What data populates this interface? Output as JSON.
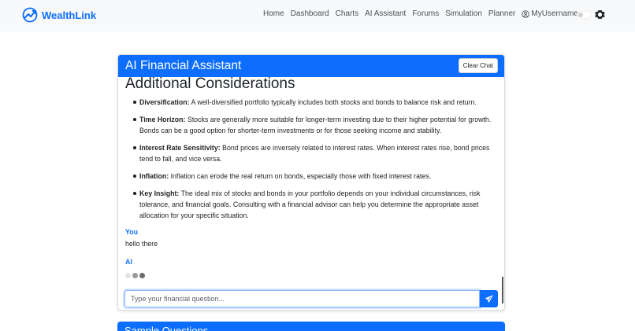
{
  "brand": {
    "name": "WealthLink",
    "icon": "chart-up-logo-icon"
  },
  "nav": {
    "links": [
      "Home",
      "Dashboard",
      "Charts",
      "AI Assistant",
      "Forums",
      "Simulation",
      "Planner"
    ],
    "user": "MyUsername",
    "user_icon": "person-circle-icon",
    "settings_icon": "gear-icon"
  },
  "chat": {
    "title": "AI Financial Assistant",
    "clear_label": "Clear Chat",
    "section_heading": "Additional Considerations",
    "bullets": [
      {
        "term": "Diversification:",
        "text": "A well-diversified portfolio typically includes both stocks and bonds to balance risk and return."
      },
      {
        "term": "Time Horizon:",
        "text": "Stocks are generally more suitable for longer-term investing due to their higher potential for growth. Bonds can be a good option for shorter-term investments or for those seeking income and stability."
      },
      {
        "term": "Interest Rate Sensitivity:",
        "text": "Bond prices are inversely related to interest rates. When interest rates rise, bond prices tend to fall, and vice versa."
      },
      {
        "term": "Inflation:",
        "text": "Inflation can erode the real return on bonds, especially those with fixed interest rates."
      },
      {
        "term": "Key Insight:",
        "text": "The ideal mix of stocks and bonds in your portfolio depends on your individual circumstances, risk tolerance, and financial goals. Consulting with a financial advisor can help you determine the appropriate asset allocation for your specific situation."
      }
    ],
    "user_label": "You",
    "user_message": "hello there",
    "ai_label": "AI",
    "input_placeholder": "Type your financial question...",
    "input_value": "",
    "send_icon": "send-icon"
  },
  "sample": {
    "title": "Sample Questions"
  },
  "colors": {
    "primary": "#0d6efd",
    "navbar_bg": "#f8f9fa"
  }
}
